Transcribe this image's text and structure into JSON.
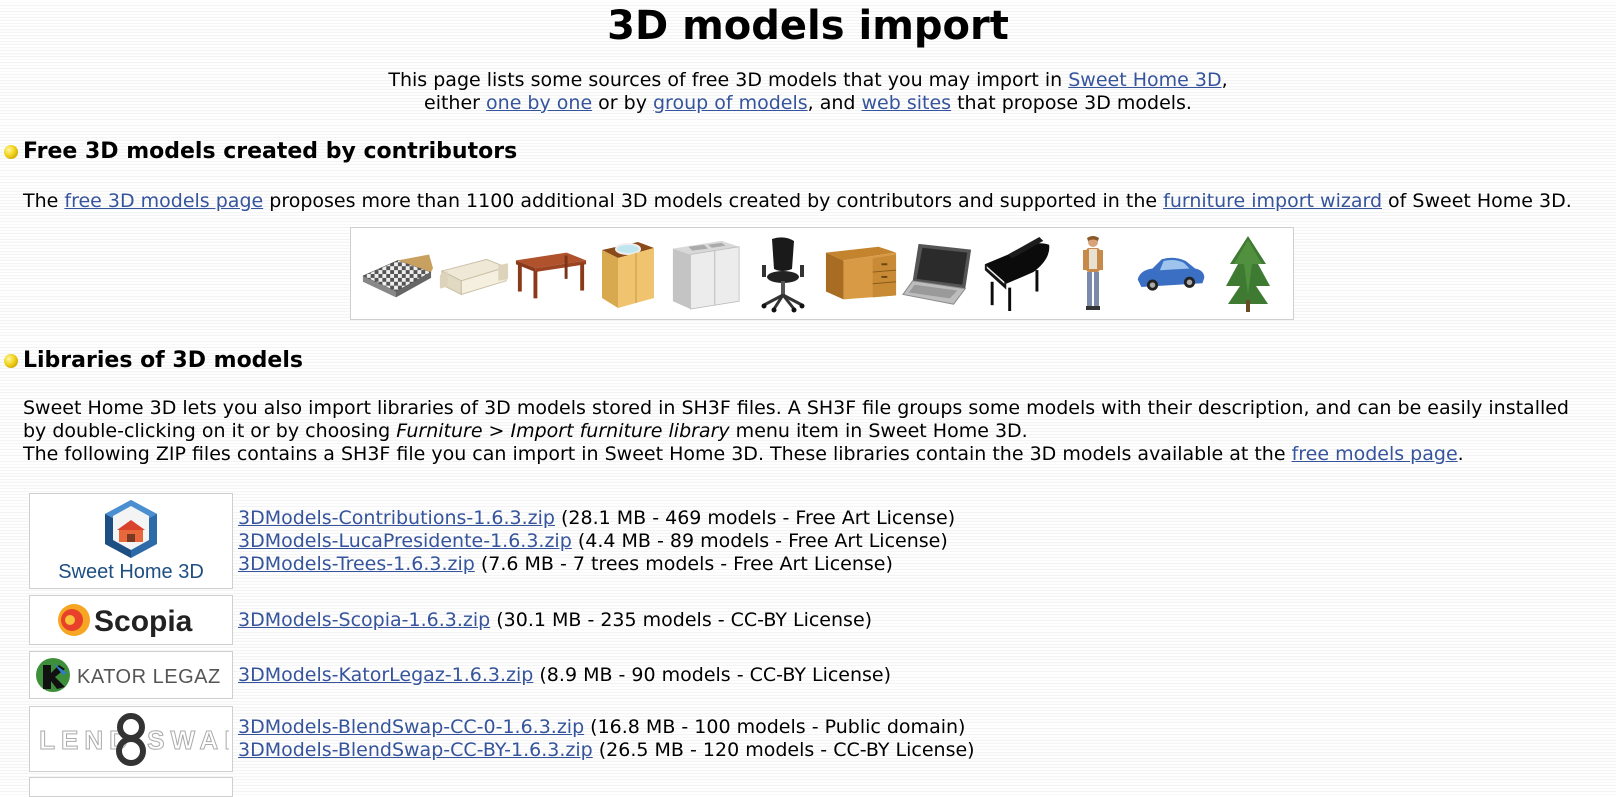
{
  "page": {
    "title": "3D models import"
  },
  "intro": {
    "line1_prefix": "This page lists some sources of free 3D models that you may import in ",
    "sweet_home_link": "Sweet Home 3D",
    "line1_suffix": ",",
    "line2_prefix": "either ",
    "one_by_one_link": "one by one",
    "line2_mid1": " or by ",
    "group_link": "group of models",
    "line2_mid2": ", and ",
    "web_sites_link": "web sites",
    "line2_suffix": " that propose 3D models."
  },
  "section_free": {
    "heading": "Free 3D models created by contributors",
    "text_prefix": "The ",
    "free_page_link": "free 3D models page",
    "text_mid": " proposes more than 1100 additional 3D models created by contributors and supported in the ",
    "wizard_link": "furniture import wizard",
    "text_suffix": " of Sweet Home 3D.",
    "thumbnails": [
      "bed",
      "sofa",
      "table",
      "bathroom-cabinet",
      "kitchen-sink-cabinet",
      "office-chair",
      "desk",
      "laptop",
      "grand-piano",
      "man",
      "car",
      "tree"
    ]
  },
  "section_libraries": {
    "heading": "Libraries of 3D models",
    "para1_prefix": "Sweet Home 3D lets you also import libraries of 3D models stored in SH3F files. A SH3F file groups some models with their description, and can be easily installed by double-clicking on it or by choosing ",
    "para1_menu": "Furniture > Import furniture library",
    "para1_suffix": " menu item in Sweet Home 3D.",
    "para2_prefix": "The following ZIP files contains a SH3F file you can import in Sweet Home 3D. These libraries contain the 3D models available at the ",
    "free_models_link": "free models page",
    "para2_suffix": "."
  },
  "libraries": [
    {
      "logo": "Sweet Home 3D",
      "files": [
        {
          "name": "3DModels-Contributions-1.6.3.zip",
          "info": " (28.1 MB - 469 models - Free Art License)"
        },
        {
          "name": "3DModels-LucaPresidente-1.6.3.zip",
          "info": " (4.4 MB - 89 models - Free Art License)"
        },
        {
          "name": "3DModels-Trees-1.6.3.zip",
          "info": " (7.6 MB - 7 trees models - Free Art License)"
        }
      ]
    },
    {
      "logo": "Scopia",
      "files": [
        {
          "name": "3DModels-Scopia-1.6.3.zip",
          "info": " (30.1 MB - 235 models - CC-BY License)"
        }
      ]
    },
    {
      "logo": "KATOR LEGAZ",
      "files": [
        {
          "name": "3DModels-KatorLegaz-1.6.3.zip",
          "info": " (8.9 MB - 90 models - CC-BY License)"
        }
      ]
    },
    {
      "logo": "BLEND SWAP",
      "files": [
        {
          "name": "3DModels-BlendSwap-CC-0-1.6.3.zip",
          "info": " (16.8 MB - 100 models - Public domain)"
        },
        {
          "name": "3DModels-BlendSwap-CC-BY-1.6.3.zip",
          "info": " (26.5 MB - 120 models - CC-BY License)"
        }
      ]
    }
  ]
}
